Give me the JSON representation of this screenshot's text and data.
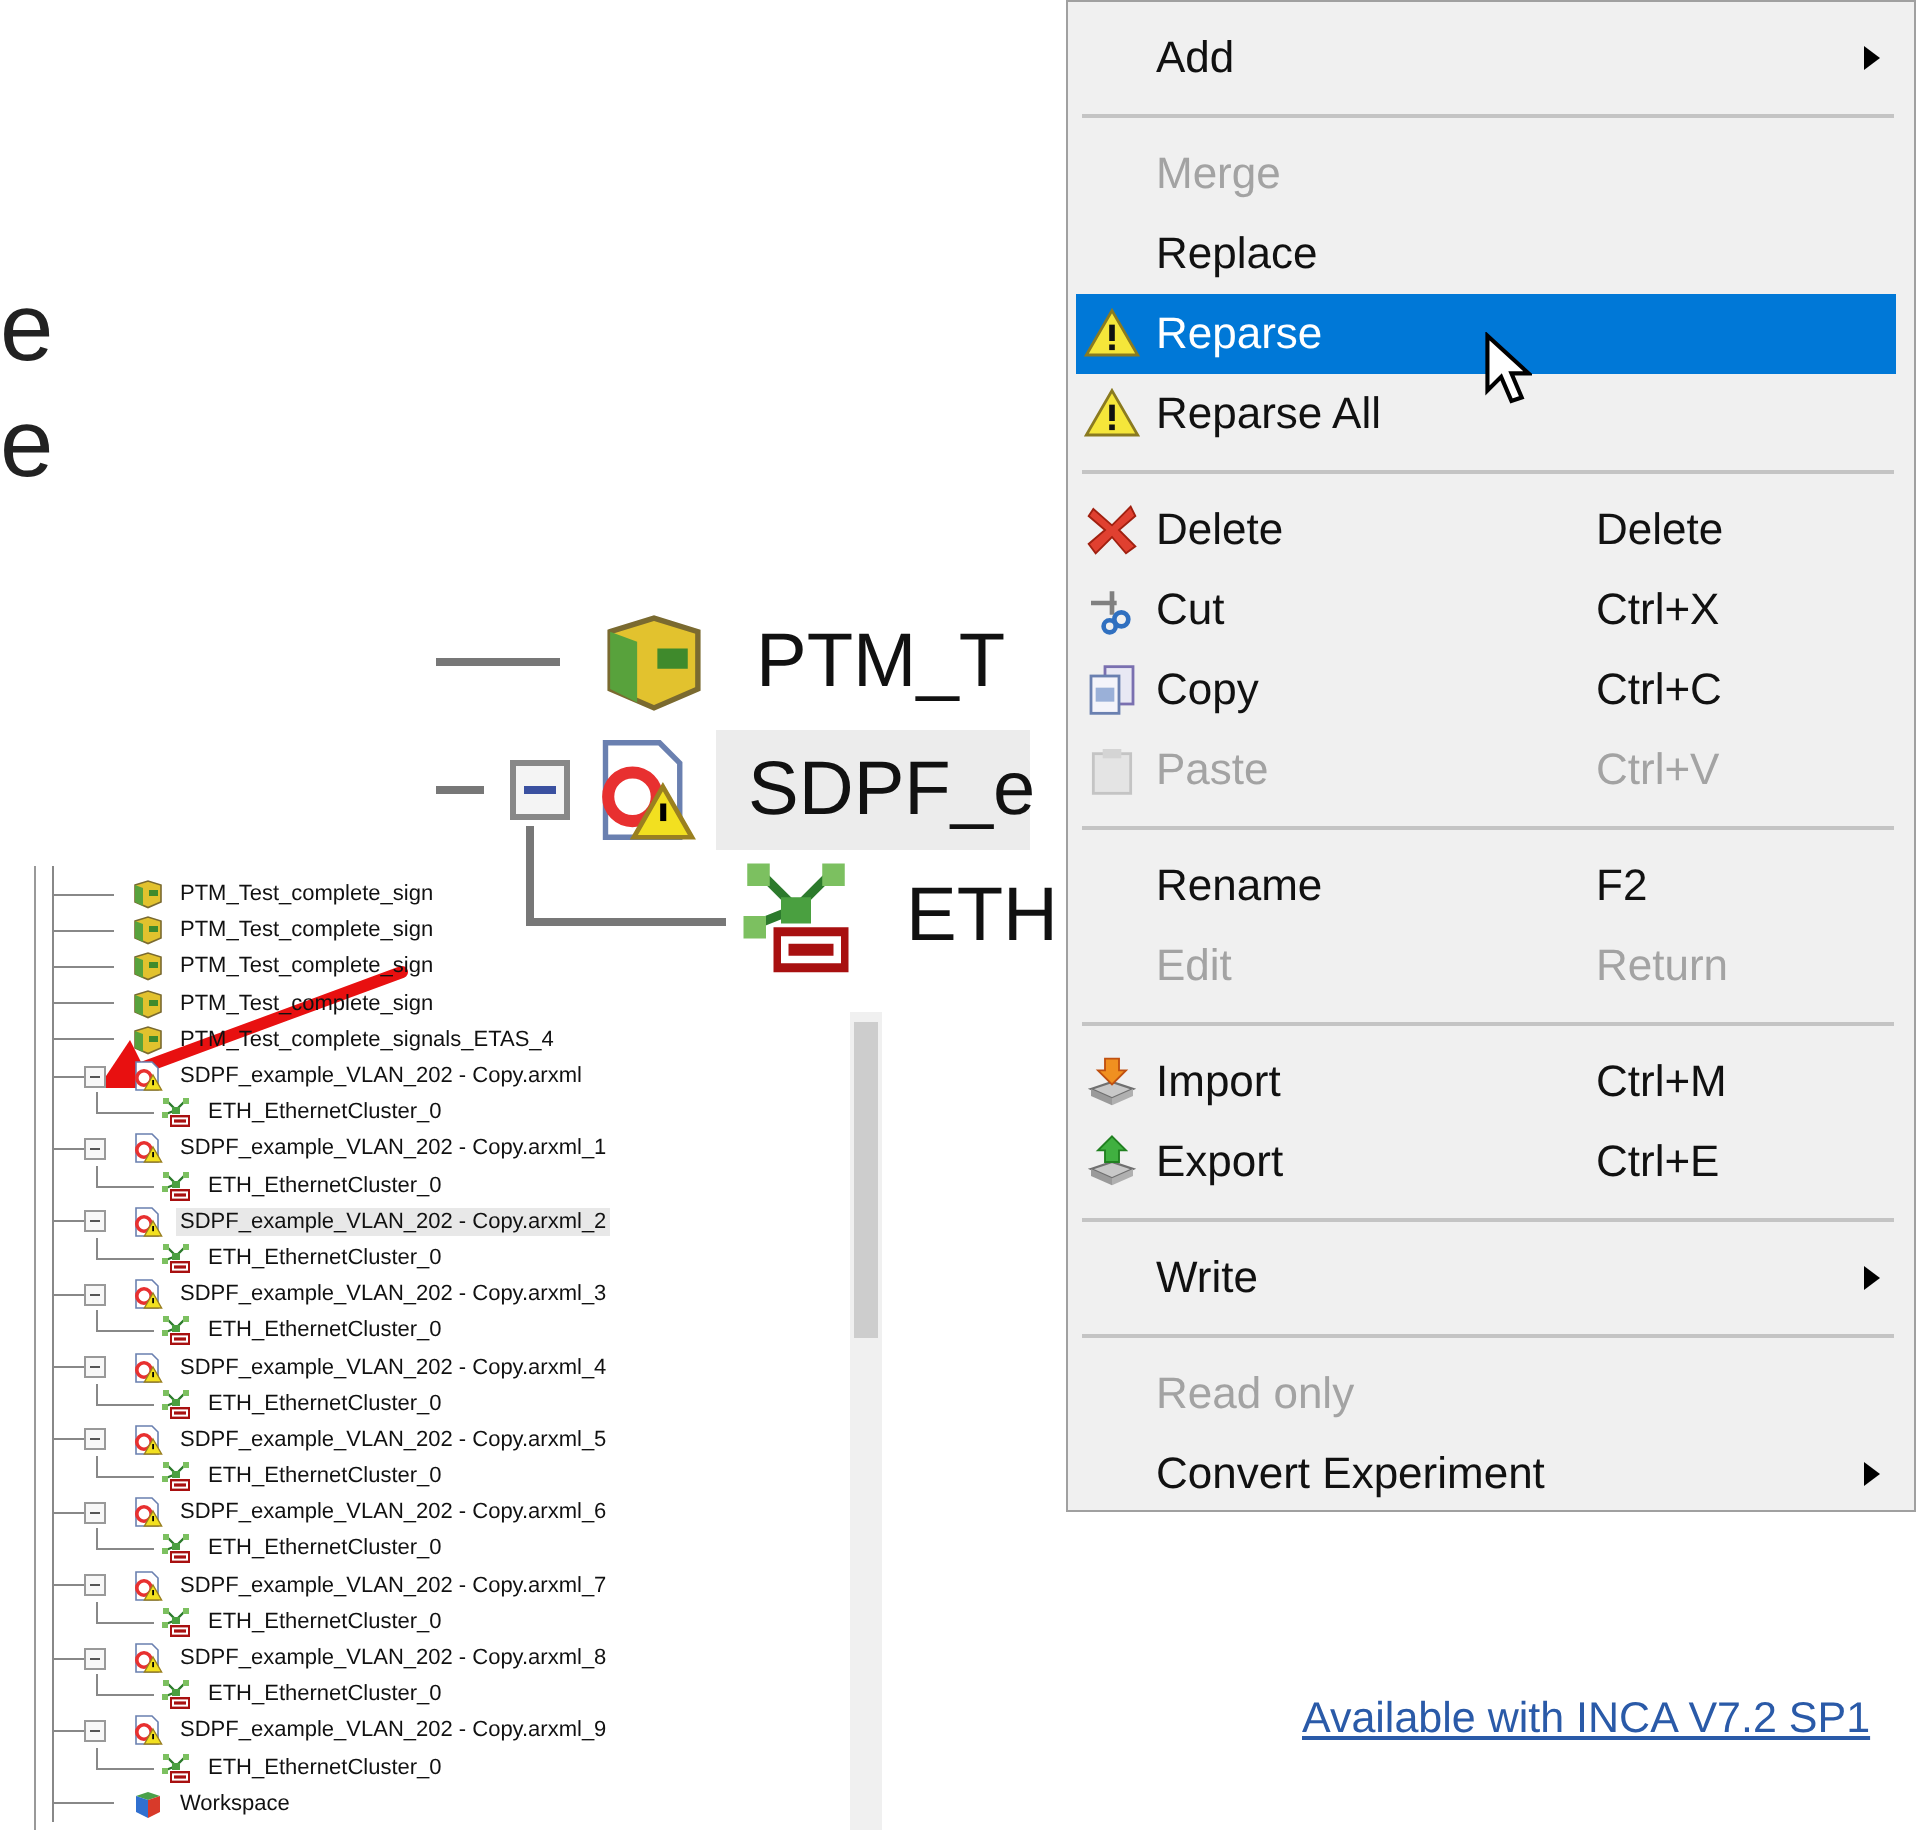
{
  "slide_fragments": [
    "e",
    "e"
  ],
  "zoom_inset": {
    "rows": [
      {
        "label": "PTM_T",
        "kind": "project",
        "selected": false
      },
      {
        "label": "SDPF_e",
        "kind": "file",
        "expanded": true,
        "selected": true,
        "children": [
          {
            "label": "ETH",
            "kind": "cluster",
            "selected": false
          }
        ]
      }
    ]
  },
  "tree": {
    "items": [
      {
        "label": "PTM_Test_complete_sign",
        "kind": "project",
        "selected": false
      },
      {
        "label": "PTM_Test_complete_sign",
        "kind": "project",
        "selected": false
      },
      {
        "label": "PTM_Test_complete_sign",
        "kind": "project",
        "selected": false
      },
      {
        "label": "PTM_Test_complete_sign",
        "kind": "project",
        "selected": false
      },
      {
        "label": "PTM_Test_complete_signals_ETAS_4",
        "kind": "project",
        "selected": false
      },
      {
        "label": "SDPF_example_VLAN_202 - Copy.arxml",
        "kind": "file",
        "expanded": true,
        "selected": false,
        "children": [
          {
            "label": "ETH_EthernetCluster_0",
            "kind": "cluster",
            "selected": false
          }
        ]
      },
      {
        "label": "SDPF_example_VLAN_202 - Copy.arxml_1",
        "kind": "file",
        "expanded": true,
        "selected": false,
        "children": [
          {
            "label": "ETH_EthernetCluster_0",
            "kind": "cluster",
            "selected": false
          }
        ]
      },
      {
        "label": "SDPF_example_VLAN_202 - Copy.arxml_2",
        "kind": "file",
        "expanded": true,
        "selected": true,
        "children": [
          {
            "label": "ETH_EthernetCluster_0",
            "kind": "cluster",
            "selected": false
          }
        ]
      },
      {
        "label": "SDPF_example_VLAN_202 - Copy.arxml_3",
        "kind": "file",
        "expanded": true,
        "selected": false,
        "children": [
          {
            "label": "ETH_EthernetCluster_0",
            "kind": "cluster",
            "selected": false
          }
        ]
      },
      {
        "label": "SDPF_example_VLAN_202 - Copy.arxml_4",
        "kind": "file",
        "expanded": true,
        "selected": false,
        "children": [
          {
            "label": "ETH_EthernetCluster_0",
            "kind": "cluster",
            "selected": false
          }
        ]
      },
      {
        "label": "SDPF_example_VLAN_202 - Copy.arxml_5",
        "kind": "file",
        "expanded": true,
        "selected": false,
        "children": [
          {
            "label": "ETH_EthernetCluster_0",
            "kind": "cluster",
            "selected": false
          }
        ]
      },
      {
        "label": "SDPF_example_VLAN_202 - Copy.arxml_6",
        "kind": "file",
        "expanded": true,
        "selected": false,
        "children": [
          {
            "label": "ETH_EthernetCluster_0",
            "kind": "cluster",
            "selected": false
          }
        ]
      },
      {
        "label": "SDPF_example_VLAN_202 - Copy.arxml_7",
        "kind": "file",
        "expanded": true,
        "selected": false,
        "children": [
          {
            "label": "ETH_EthernetCluster_0",
            "kind": "cluster",
            "selected": false
          }
        ]
      },
      {
        "label": "SDPF_example_VLAN_202 - Copy.arxml_8",
        "kind": "file",
        "expanded": true,
        "selected": false,
        "children": [
          {
            "label": "ETH_EthernetCluster_0",
            "kind": "cluster",
            "selected": false
          }
        ]
      },
      {
        "label": "SDPF_example_VLAN_202 - Copy.arxml_9",
        "kind": "file",
        "expanded": true,
        "selected": false,
        "children": [
          {
            "label": "ETH_EthernetCluster_0",
            "kind": "cluster",
            "selected": false
          }
        ]
      },
      {
        "label": "Workspace",
        "kind": "workspace",
        "selected": false
      }
    ]
  },
  "context_menu": {
    "items": [
      {
        "kind": "plain",
        "label": "Add",
        "submenu": true,
        "disabled": false,
        "selected": false
      },
      {
        "kind": "separator"
      },
      {
        "kind": "plain",
        "label": "Merge",
        "disabled": true,
        "selected": false
      },
      {
        "kind": "plain",
        "label": "Replace",
        "disabled": false,
        "selected": false
      },
      {
        "kind": "warning",
        "label": "Reparse",
        "disabled": false,
        "selected": true
      },
      {
        "kind": "warning",
        "label": "Reparse All",
        "disabled": false,
        "selected": false
      },
      {
        "kind": "separator"
      },
      {
        "kind": "delete",
        "label": "Delete",
        "shortcut": "Delete",
        "disabled": false,
        "selected": false
      },
      {
        "kind": "cut",
        "label": "Cut",
        "shortcut": "Ctrl+X",
        "disabled": false,
        "selected": false
      },
      {
        "kind": "copy",
        "label": "Copy",
        "shortcut": "Ctrl+C",
        "disabled": false,
        "selected": false
      },
      {
        "kind": "paste",
        "label": "Paste",
        "shortcut": "Ctrl+V",
        "disabled": true,
        "selected": false
      },
      {
        "kind": "separator"
      },
      {
        "kind": "plain",
        "label": "Rename",
        "shortcut": "F2",
        "disabled": false,
        "selected": false
      },
      {
        "kind": "plain",
        "label": "Edit",
        "shortcut": "Return",
        "disabled": true,
        "selected": false
      },
      {
        "kind": "separator"
      },
      {
        "kind": "import",
        "label": "Import",
        "shortcut": "Ctrl+M",
        "disabled": false,
        "selected": false
      },
      {
        "kind": "export",
        "label": "Export",
        "shortcut": "Ctrl+E",
        "disabled": false,
        "selected": false
      },
      {
        "kind": "separator"
      },
      {
        "kind": "plain",
        "label": "Write",
        "submenu": true,
        "disabled": false,
        "selected": false
      },
      {
        "kind": "separator"
      },
      {
        "kind": "plain",
        "label": "Read only",
        "disabled": true,
        "selected": false
      },
      {
        "kind": "plain",
        "label": "Convert Experiment",
        "submenu": true,
        "disabled": false,
        "selected": false
      }
    ]
  },
  "footer_link": "Available with INCA V7.2 SP1"
}
